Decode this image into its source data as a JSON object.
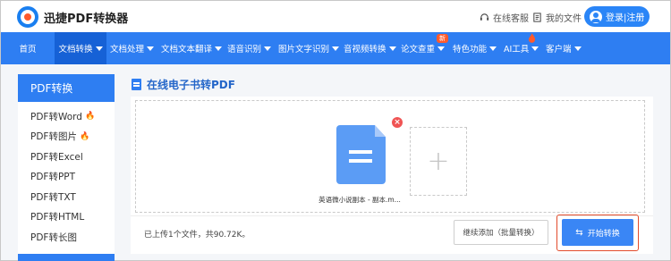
{
  "brand": {
    "name": "迅捷PDF转换器"
  },
  "header_links": [
    {
      "label": "在线客服",
      "icon": "headset-icon"
    },
    {
      "label": "我的文件",
      "icon": "file-list-icon"
    }
  ],
  "login": {
    "label": "登录|注册"
  },
  "nav": [
    {
      "label": "首页",
      "has_caret": false,
      "active": false
    },
    {
      "label": "文档转换",
      "has_caret": true,
      "active": true
    },
    {
      "label": "文档处理",
      "has_caret": true,
      "active": false
    },
    {
      "label": "文档文本翻译",
      "has_caret": true,
      "active": false
    },
    {
      "label": "语音识别",
      "has_caret": true,
      "active": false
    },
    {
      "label": "图片文字识别",
      "has_caret": true,
      "active": false
    },
    {
      "label": "音视频转换",
      "has_caret": true,
      "active": false
    },
    {
      "label": "论文查重",
      "has_caret": true,
      "active": false
    },
    {
      "label": "特色功能",
      "has_caret": true,
      "active": false
    },
    {
      "label": "AI工具",
      "has_caret": true,
      "active": false
    },
    {
      "label": "客户端",
      "has_caret": true,
      "active": false
    }
  ],
  "nav_badge": "新",
  "sidebar": {
    "title": "PDF转换",
    "items": [
      {
        "label": "PDF转Word",
        "hot": true
      },
      {
        "label": "PDF转图片",
        "hot": true
      },
      {
        "label": "PDF转Excel",
        "hot": false
      },
      {
        "label": "PDF转PPT",
        "hot": false
      },
      {
        "label": "PDF转TXT",
        "hot": false
      },
      {
        "label": "PDF转HTML",
        "hot": false
      },
      {
        "label": "PDF转长图",
        "hot": false
      }
    ]
  },
  "main": {
    "title": "在线电子书转PDF",
    "file_name": "英语微小说副本 - 副本.m...",
    "status": "已上传1个文件，共90.72K。",
    "continue_button": "继续添加（批量转换）",
    "start_button": "开始转换"
  },
  "colors": {
    "primary": "#2e7ef2",
    "active_nav": "#1661d6",
    "accent": "#ff5a2c",
    "highlight": "#e24b2b"
  }
}
